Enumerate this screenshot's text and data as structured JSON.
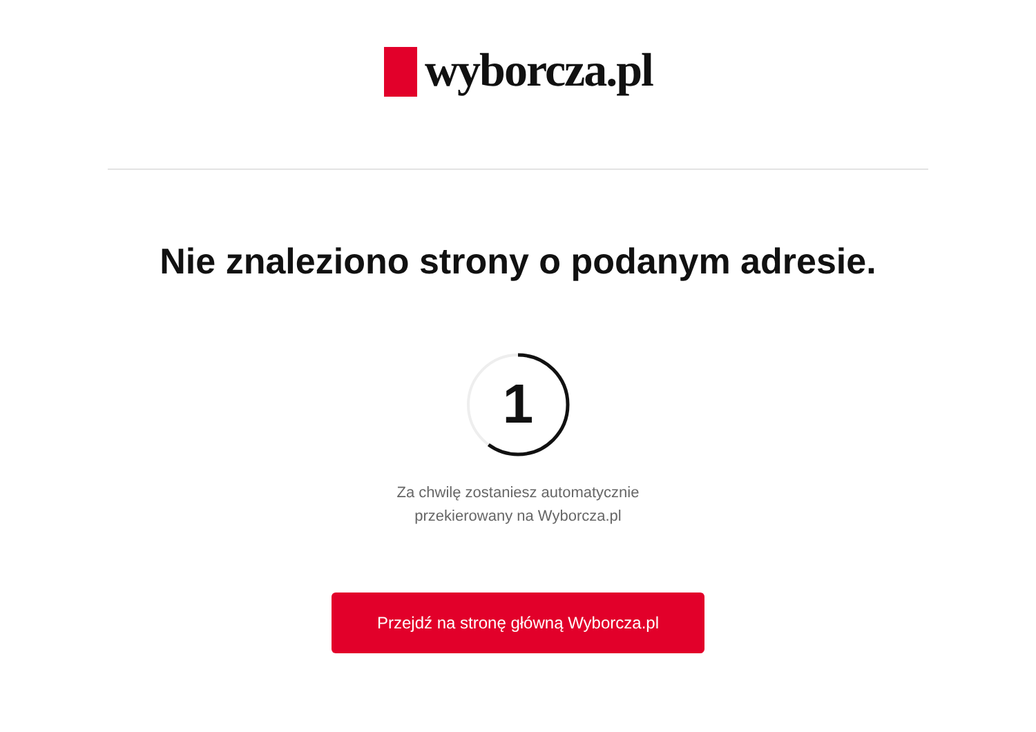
{
  "logo": {
    "text": "wyborcza.pl"
  },
  "heading": "Nie znaleziono strony o podanym adresie.",
  "countdown": {
    "value": "1",
    "level": 0.6
  },
  "message": [
    "Za chwilę zostaniesz automatycznie",
    "przekierowany na Wyborcza.pl"
  ],
  "button": "Przejdź na stronę główną Wyborcza.pl"
}
